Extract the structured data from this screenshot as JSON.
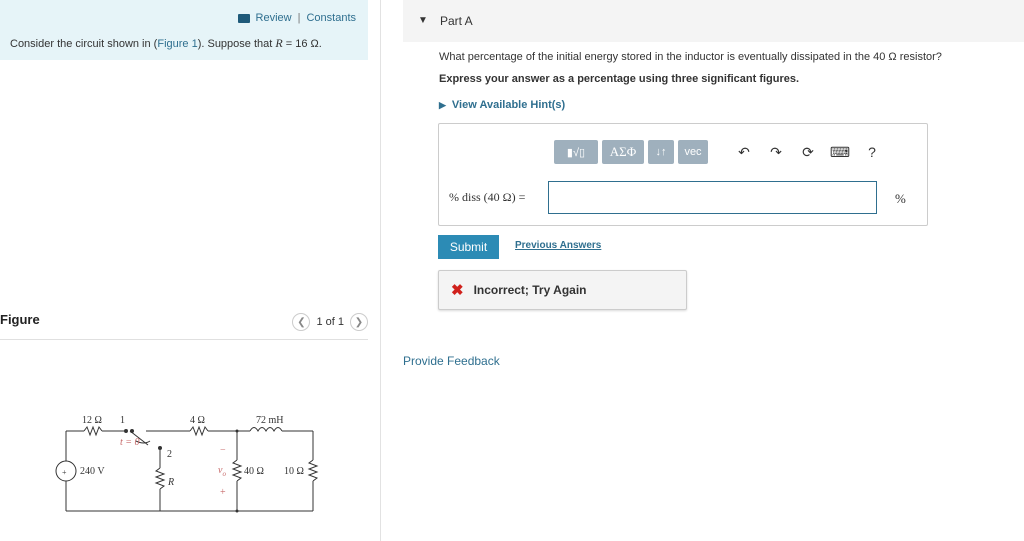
{
  "header": {
    "review": "Review",
    "separator": "|",
    "constants": "Constants"
  },
  "problem": {
    "prefix": "Consider the circuit shown in (",
    "figure_link": "Figure 1",
    "suffix": "). Suppose that ",
    "math": "R",
    "value": " = 16 Ω."
  },
  "figure": {
    "title": "Figure",
    "pager": "1 of 1",
    "labels": {
      "r12": "12 Ω",
      "sw1": "1",
      "t0": "t = 0",
      "sw2": "2",
      "r4": "4 Ω",
      "l72": "72 mH",
      "v240": "240 V",
      "r": "R",
      "vo": "v",
      "vo_sub": "o",
      "minus": "−",
      "plus": "+",
      "r40": "40 Ω",
      "r10": "10 Ω"
    }
  },
  "part": {
    "label": "Part A",
    "question": "What percentage of the initial energy stored in the inductor is eventually dissipated in the 40 Ω resistor?",
    "instruction": "Express your answer as a percentage using three significant figures.",
    "hint": "View Available Hint(s)"
  },
  "toolbar": {
    "templates": "▮√▯",
    "greek": "ΑΣΦ",
    "sort": "↓↑",
    "vec": "vec",
    "undo": "↶",
    "redo": "↷",
    "reset": "⟳",
    "keyboard": "⌨",
    "help": "?"
  },
  "answer": {
    "label": "% diss (40 Ω) =",
    "value": "",
    "unit": "%"
  },
  "buttons": {
    "submit": "Submit",
    "previous": "Previous Answers"
  },
  "feedback": {
    "icon": "✖",
    "message": "Incorrect; Try Again"
  },
  "footer": {
    "provide_feedback": "Provide Feedback"
  }
}
